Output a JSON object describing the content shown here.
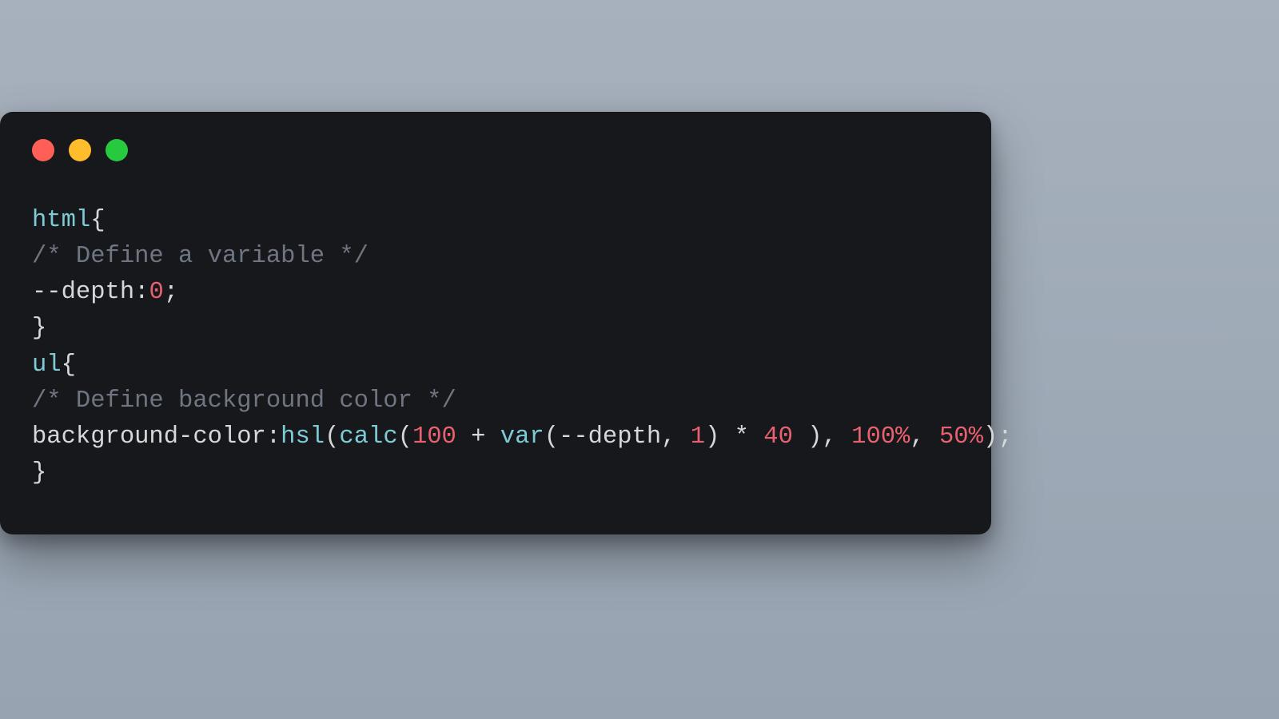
{
  "window": {
    "dots": [
      "close",
      "minimize",
      "zoom"
    ]
  },
  "code": {
    "line1_selector": "html",
    "line1_brace": "{",
    "line2_comment": "/* Define a variable */",
    "line3_prop": "--depth",
    "line3_colon": ":",
    "line3_value": "0",
    "line3_semi": ";",
    "line4_brace": "}",
    "line5_selector": "ul",
    "line5_brace": "{",
    "line6_comment": "/* Define background color */",
    "line7_prop": "background-color",
    "line7_colon": ":",
    "line7_fn_hsl": "hsl",
    "line7_paren_open1": "(",
    "line7_fn_calc": "calc",
    "line7_paren_open2": "(",
    "line7_num1": "100",
    "line7_plus": " + ",
    "line7_fn_var": "var",
    "line7_paren_open3": "(",
    "line7_varname": "--depth",
    "line7_comma1": ", ",
    "line7_num2": "1",
    "line7_paren_close3": ")",
    "line7_times": " * ",
    "line7_num3": "40",
    "line7_space": " ",
    "line7_paren_close2": ")",
    "line7_comma2": ", ",
    "line7_num4": "100%",
    "line7_comma3": ", ",
    "line7_num5": "50%",
    "line7_paren_close1": ")",
    "line7_semi": ";",
    "line8_brace": "}"
  }
}
